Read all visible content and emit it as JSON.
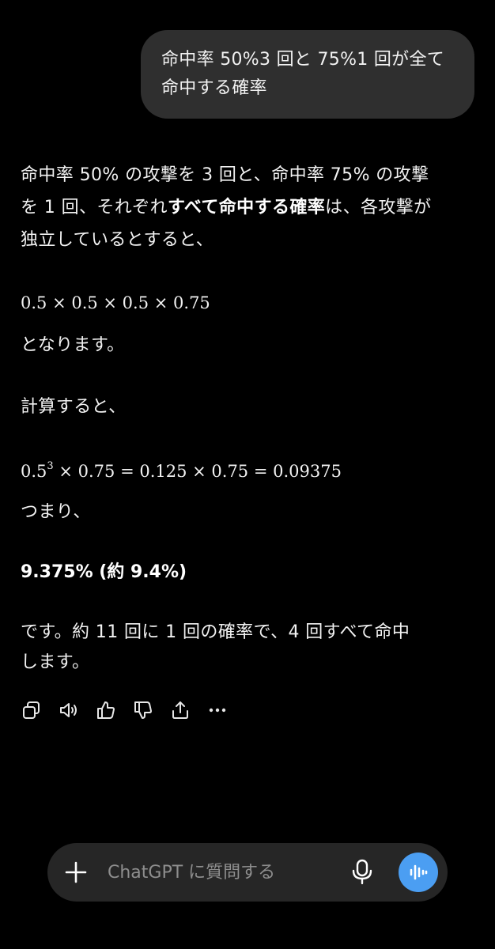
{
  "user_message": {
    "line1": "命中率 50%3 回と 75%1 回が全て",
    "line2": "命中する確率"
  },
  "assistant": {
    "intro_line1": "命中率 50% の攻撃を 3 回と、命中率 75% の攻撃",
    "intro_line2_a": "を 1 回、それぞれ",
    "intro_line2_bold": "すべて命中する確率",
    "intro_line2_b": "は、各攻撃が",
    "intro_line3": "独立しているとすると、",
    "formula1": "0.5 × 0.5 × 0.5 × 0.75",
    "becomes": "となります。",
    "calc_label": "計算すると、",
    "formula2_base": "0.5",
    "formula2_exp": "3",
    "formula2_rest": " × 0.75 = 0.125 × 0.75 = 0.09375",
    "so": "つまり、",
    "result": "9.375% (約 9.4%)",
    "closing_line1": "です。約 11 回に 1 回の確率で、4 回すべて命中",
    "closing_line2": "します。"
  },
  "actions": [
    {
      "name": "copy-icon"
    },
    {
      "name": "read-aloud-icon"
    },
    {
      "name": "thumbs-up-icon"
    },
    {
      "name": "thumbs-down-icon"
    },
    {
      "name": "share-icon"
    },
    {
      "name": "more-icon"
    }
  ],
  "composer": {
    "placeholder": "ChatGPT に質問する",
    "plus_icon": "plus-icon",
    "mic_icon": "microphone-icon",
    "voice_icon": "voice-mode-icon",
    "voice_color": "#4b9ef2"
  }
}
